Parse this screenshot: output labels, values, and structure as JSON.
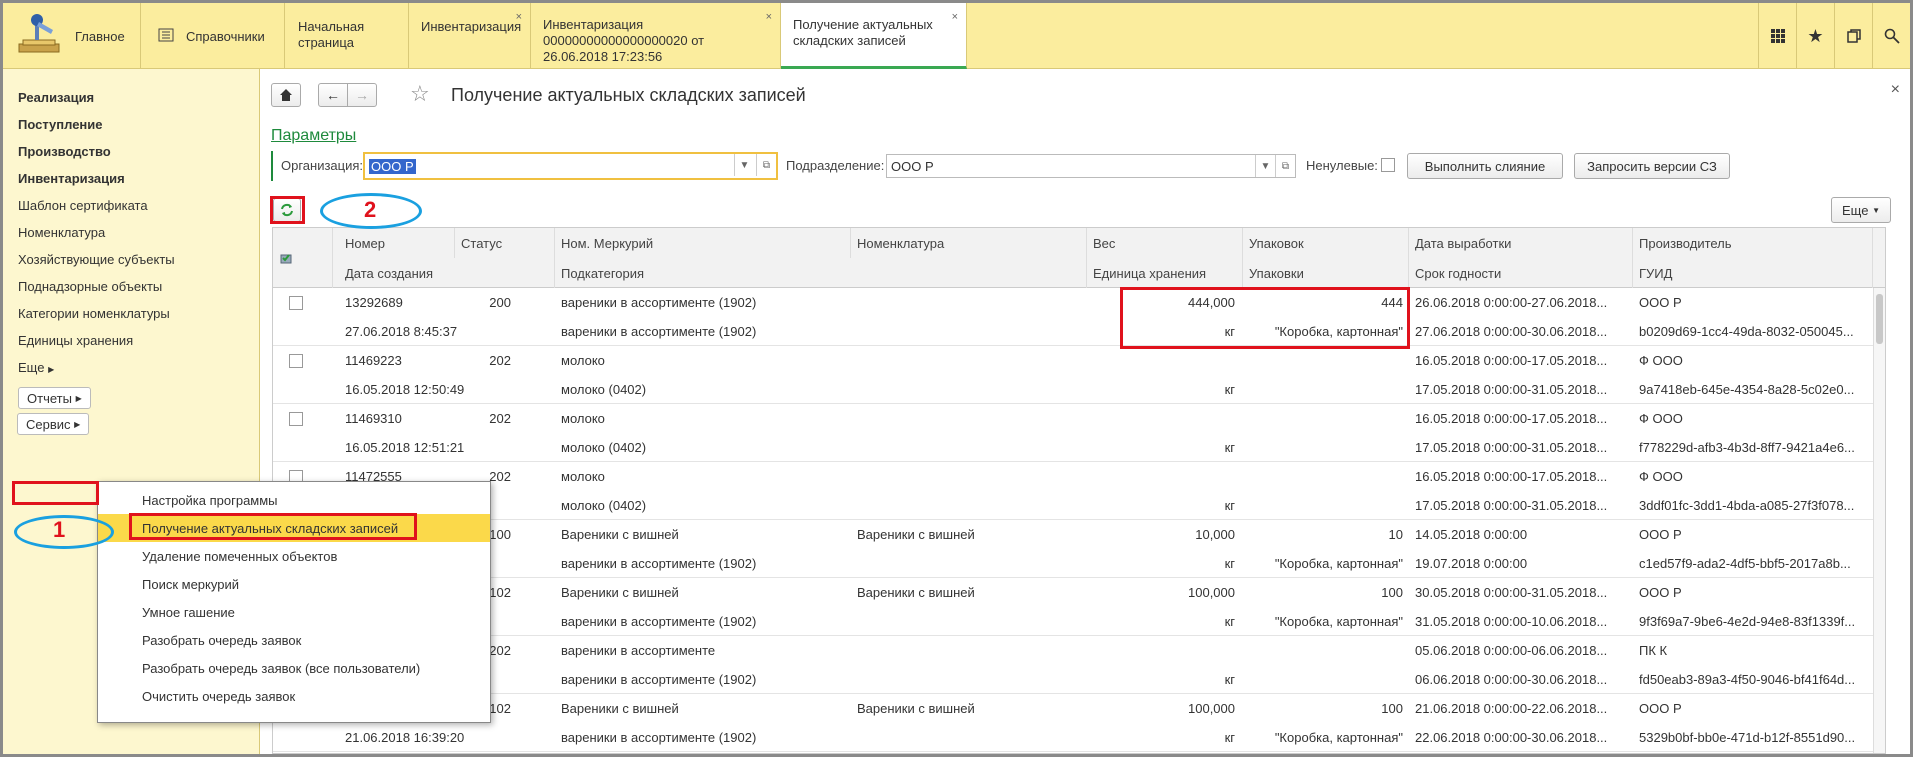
{
  "topbar": {
    "home_label": "Главное",
    "references_label": "Справочники",
    "tabs": [
      {
        "label": "Начальная страница",
        "closable": false
      },
      {
        "label": "Инвентаризация",
        "closable": true
      },
      {
        "label": "Инвентаризация 00000000000000000020 от 26.06.2018 17:23:56",
        "line1": "Инвентаризация 00000000000000000020 от",
        "line2": "26.06.2018 17:23:56",
        "closable": true
      },
      {
        "label": "Получение актуальных складских записей",
        "line1": "Получение актуальных",
        "line2": "складских записей",
        "closable": true,
        "active": true
      }
    ],
    "close_glyph": "×"
  },
  "sidebar": {
    "items": [
      {
        "label": "Реализация",
        "bold": true
      },
      {
        "label": "Поступление",
        "bold": true
      },
      {
        "label": "Производство",
        "bold": true
      },
      {
        "label": "Инвентаризация",
        "bold": true
      },
      {
        "label": "Шаблон сертификата"
      },
      {
        "label": "Номенклатура"
      },
      {
        "label": "Хозяйствующие субъекты"
      },
      {
        "label": "Поднадзорные объекты"
      },
      {
        "label": "Категории номенклатуры"
      },
      {
        "label": "Единицы хранения"
      },
      {
        "label": "Еще"
      }
    ],
    "reports_label": "Отчеты",
    "service_label": "Сервис"
  },
  "popup_menu": {
    "items": [
      "Настройка программы",
      "Получение актуальных складских записей",
      "Удаление помеченных объектов",
      "Поиск меркурий",
      "Умное гашение",
      "Разобрать очередь заявок",
      "Разобрать очередь заявок (все пользователи)",
      "Очистить очередь заявок"
    ],
    "active_index": 1
  },
  "content": {
    "title": "Получение актуальных складских записей",
    "params_link": "Параметры",
    "org_label": "Организация:",
    "org_value": "ООО Р",
    "dept_label": "Подразделение:",
    "dept_value": "ООО Р",
    "nonzero_label": "Ненулевые:",
    "merge_button": "Выполнить слияние",
    "request_button": "Запросить версии СЗ",
    "more_button": "Еще",
    "close_glyph": "×"
  },
  "table": {
    "headers_top": [
      "Номер",
      "Статус",
      "Ном. Меркурий",
      "Номенклатура",
      "Вес",
      "Упаковок",
      "Дата выработки",
      "Производитель"
    ],
    "headers_bottom": [
      "Дата создания",
      "Подкатегория",
      "Единица хранения",
      "Упаковки",
      "Срок годности",
      "ГУИД"
    ],
    "rows": [
      {
        "num": "13292689",
        "status": "200",
        "merc": "вареники в ассортименте (1902)",
        "nom": "",
        "weight": "444,000",
        "packs": "444",
        "prod_date": "26.06.2018 0:00:00-27.06.2018...",
        "producer": "ООО Р",
        "created": "27.06.2018 8:45:37",
        "subcat": "вареники в ассортименте (1902)",
        "unit": "кг",
        "pack_type": "\"Коробка, картонная\"",
        "expiry": "27.06.2018 0:00:00-30.06.2018...",
        "guid": "b0209d69-1cc4-49da-8032-050045..."
      },
      {
        "num": "11469223",
        "status": "202",
        "merc": "молоко",
        "nom": "",
        "weight": "",
        "packs": "",
        "prod_date": "16.05.2018 0:00:00-17.05.2018...",
        "producer": "Ф              ООО",
        "created": "16.05.2018 12:50:49",
        "subcat": "молоко (0402)",
        "unit": "кг",
        "pack_type": "",
        "expiry": "17.05.2018 0:00:00-31.05.2018...",
        "guid": "9a7418eb-645e-4354-8a28-5c02e0..."
      },
      {
        "num": "11469310",
        "status": "202",
        "merc": "молоко",
        "nom": "",
        "weight": "",
        "packs": "",
        "prod_date": "16.05.2018 0:00:00-17.05.2018...",
        "producer": "Ф              ООО",
        "created": "16.05.2018 12:51:21",
        "subcat": "молоко (0402)",
        "unit": "кг",
        "pack_type": "",
        "expiry": "17.05.2018 0:00:00-31.05.2018...",
        "guid": "f778229d-afb3-4b3d-8ff7-9421a4e6..."
      },
      {
        "num": "11472555",
        "status": "202",
        "merc": "молоко",
        "nom": "",
        "weight": "",
        "packs": "",
        "prod_date": "16.05.2018 0:00:00-17.05.2018...",
        "producer": "Ф              ООО",
        "created": "",
        "subcat": "молоко (0402)",
        "unit": "кг",
        "pack_type": "",
        "expiry": "17.05.2018 0:00:00-31.05.2018...",
        "guid": "3ddf01fc-3dd1-4bda-a085-27f3f078..."
      },
      {
        "num": "",
        "status": "100",
        "merc": "Вареники с вишней",
        "nom": "Вареники с вишней",
        "weight": "10,000",
        "packs": "10",
        "prod_date": "14.05.2018 0:00:00",
        "producer": "ООО Р",
        "created": "",
        "subcat": "вареники в ассортименте (1902)",
        "unit": "кг",
        "pack_type": "\"Коробка, картонная\"",
        "expiry": "19.07.2018 0:00:00",
        "guid": "c1ed57f9-ada2-4df5-bbf5-2017a8b..."
      },
      {
        "num": "",
        "status": "102",
        "merc": "Вареники с вишней",
        "nom": "Вареники с вишней",
        "weight": "100,000",
        "packs": "100",
        "prod_date": "30.05.2018 0:00:00-31.05.2018...",
        "producer": "ООО Р",
        "created": "",
        "subcat": "вареники в ассортименте (1902)",
        "unit": "кг",
        "pack_type": "\"Коробка, картонная\"",
        "expiry": "31.05.2018 0:00:00-10.06.2018...",
        "guid": "9f3f69a7-9be6-4e2d-94e8-83f1339f..."
      },
      {
        "num": "",
        "status": "202",
        "merc": "вареники в ассортименте",
        "nom": "",
        "weight": "",
        "packs": "",
        "prod_date": "05.06.2018 0:00:00-06.06.2018...",
        "producer": "ПК К",
        "created": "",
        "subcat": "вареники в ассортименте (1902)",
        "unit": "кг",
        "pack_type": "",
        "expiry": "06.06.2018 0:00:00-30.06.2018...",
        "guid": "fd50eab3-89a3-4f50-9046-bf41f64d..."
      },
      {
        "num": "",
        "status": "102",
        "merc": "Вареники с вишней",
        "nom": "Вареники с вишней",
        "weight": "100,000",
        "packs": "100",
        "prod_date": "21.06.2018 0:00:00-22.06.2018...",
        "producer": "ООО Р",
        "created": "21.06.2018 16:39:20",
        "subcat": "вареники в ассортименте (1902)",
        "unit": "кг",
        "pack_type": "\"Коробка, картонная\"",
        "expiry": "22.06.2018 0:00:00-30.06.2018...",
        "guid": "5329b0bf-bb0e-471d-b12f-8551d90..."
      }
    ]
  },
  "annotations": {
    "label_1": "1",
    "label_2": "2",
    "mark_color": "#e0121c",
    "ellipse_color": "#1aa0e0"
  },
  "colors": {
    "topbar": "#fbed9e",
    "sidebar": "#fdf7cf",
    "active_menu": "#fbd94a",
    "link": "#1e8a3c",
    "active_tab_underline": "#3aa852"
  }
}
